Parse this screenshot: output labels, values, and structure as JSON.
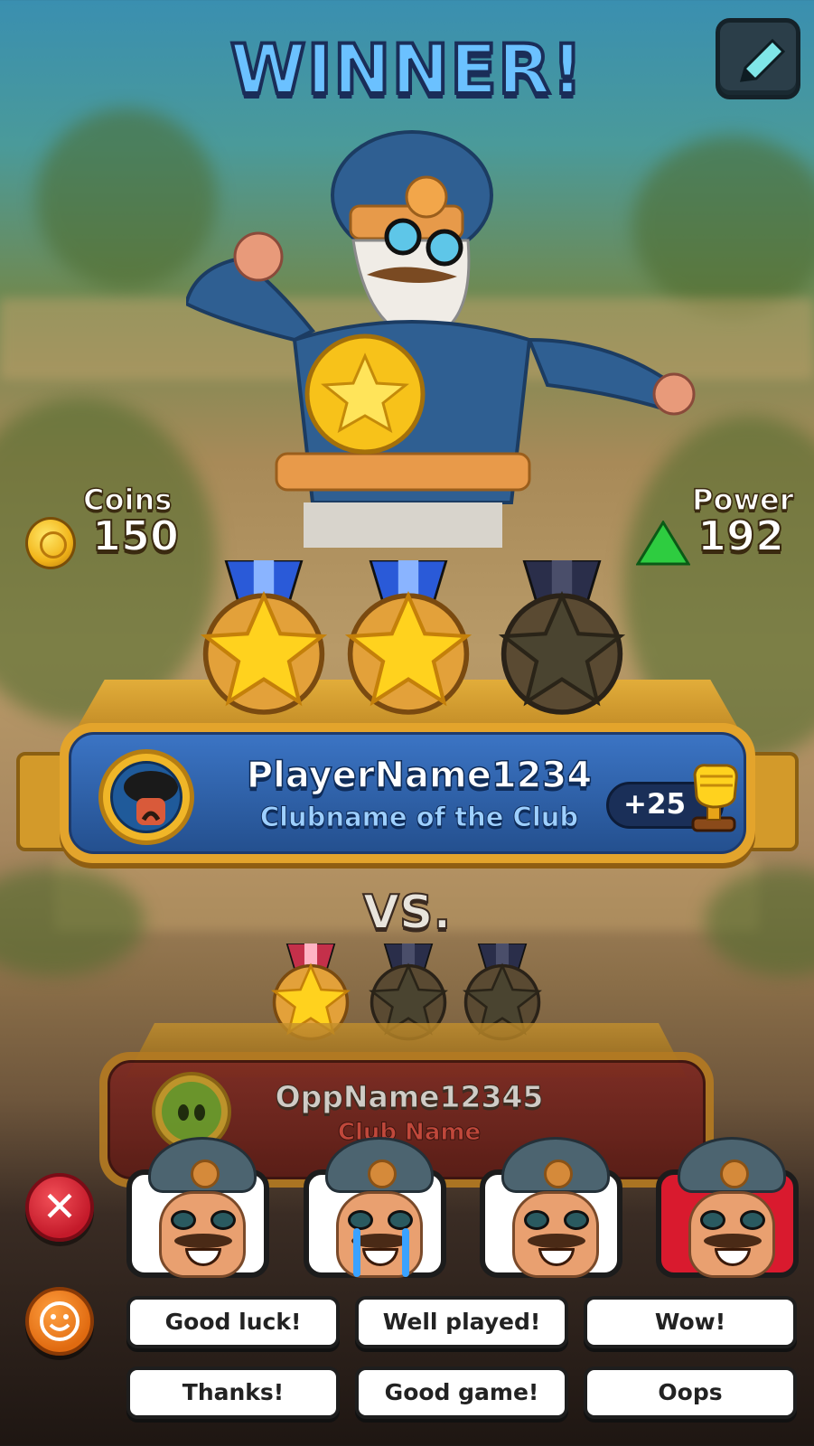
{
  "header": {
    "title": "WINNER!"
  },
  "stats": {
    "coins": {
      "label": "Coins",
      "value": "150"
    },
    "power": {
      "label": "Power",
      "value": "192"
    }
  },
  "player": {
    "name": "PlayerName1234",
    "club": "Clubname of the Club",
    "trophy_delta": "+25",
    "stars_earned": 2,
    "stars_total": 3
  },
  "versus_label": "VS.",
  "opponent": {
    "name": "OppName12345",
    "club": "Club Name",
    "stars_earned": 1,
    "stars_total": 3
  },
  "emotes": [
    {
      "icon": "happy-face-icon"
    },
    {
      "icon": "crying-face-icon"
    },
    {
      "icon": "laughing-face-icon"
    },
    {
      "icon": "angry-face-icon"
    }
  ],
  "quick_chat": [
    "Good luck!",
    "Well played!",
    "Wow!",
    "Thanks!",
    "Good game!",
    "Oops"
  ],
  "colors": {
    "title": "#6bc1ff",
    "player_banner": "#2f62ad",
    "opponent_banner": "#6e2219",
    "star_gold": "#ffd21e",
    "close_button": "#d82434",
    "emote_button": "#f07a1a",
    "power_arrow": "#2ecc40"
  }
}
